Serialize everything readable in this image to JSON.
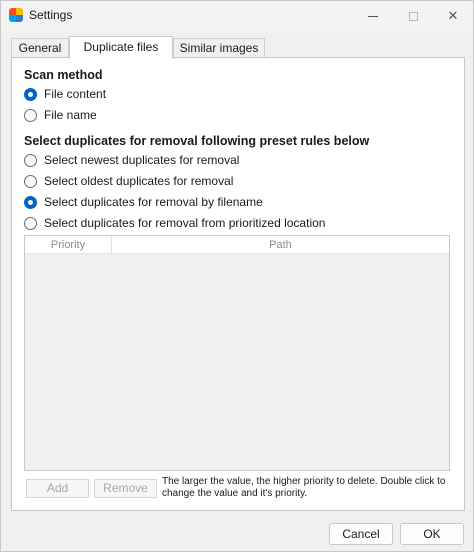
{
  "window": {
    "title": "Settings",
    "icon": "app-icon",
    "controls": {
      "minimize": "minimize-icon",
      "maximize": "maximize-icon",
      "close": "✕"
    }
  },
  "tabs": [
    {
      "label": "General",
      "active": false
    },
    {
      "label": "Duplicate files",
      "active": true
    },
    {
      "label": "Similar images",
      "active": false
    }
  ],
  "scan_method": {
    "title": "Scan method",
    "options": [
      {
        "label": "File content",
        "checked": true
      },
      {
        "label": "File name",
        "checked": false
      }
    ]
  },
  "removal_rules": {
    "title": "Select duplicates for removal following preset rules below",
    "options": [
      {
        "label": "Select newest duplicates for removal",
        "checked": false
      },
      {
        "label": "Select oldest duplicates for removal",
        "checked": false
      },
      {
        "label": "Select duplicates for removal by filename",
        "checked": true
      },
      {
        "label": "Select duplicates for removal from prioritized location",
        "checked": false
      }
    ]
  },
  "priority_table": {
    "columns": [
      "Priority",
      "Path"
    ],
    "rows": []
  },
  "table_actions": {
    "add_label": "Add",
    "remove_label": "Remove",
    "hint": "The larger the value, the higher priority to delete. Double click to change the value and it's priority."
  },
  "footer": {
    "cancel_label": "Cancel",
    "ok_label": "OK"
  },
  "colors": {
    "accent": "#0067c0"
  }
}
